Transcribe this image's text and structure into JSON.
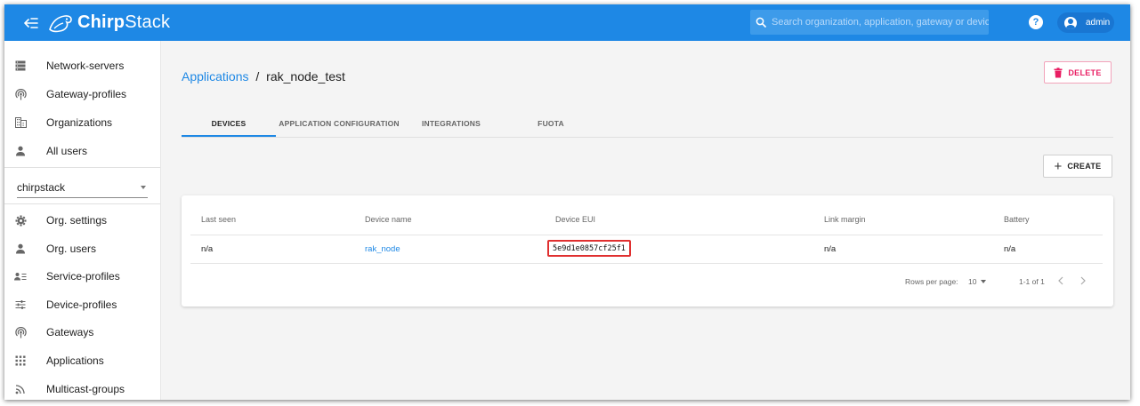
{
  "app": {
    "logo_bold": "Chirp",
    "logo_rest": "Stack"
  },
  "search": {
    "placeholder": "Search organization, application, gateway or device"
  },
  "user": {
    "help_label": "?",
    "name": "admin"
  },
  "sidebar": {
    "global_items": [
      {
        "label": "Network-servers",
        "icon": "server-icon"
      },
      {
        "label": "Gateway-profiles",
        "icon": "wifi-tethering-icon"
      },
      {
        "label": "Organizations",
        "icon": "domain-icon"
      },
      {
        "label": "All users",
        "icon": "person-icon"
      }
    ],
    "organization_selector": "chirpstack",
    "org_items": [
      {
        "label": "Org. settings",
        "icon": "gear-icon"
      },
      {
        "label": "Org. users",
        "icon": "person-icon"
      },
      {
        "label": "Service-profiles",
        "icon": "account-details-icon"
      },
      {
        "label": "Device-profiles",
        "icon": "tune-icon"
      },
      {
        "label": "Gateways",
        "icon": "wifi-tethering-icon"
      },
      {
        "label": "Applications",
        "icon": "apps-icon"
      },
      {
        "label": "Multicast-groups",
        "icon": "rss-icon"
      }
    ]
  },
  "breadcrumb": {
    "parent": "Applications",
    "separator": "/",
    "current": "rak_node_test"
  },
  "actions": {
    "delete_label": "DELETE",
    "create_label": "CREATE"
  },
  "tabs": [
    {
      "label": "DEVICES",
      "active": true
    },
    {
      "label": "APPLICATION CONFIGURATION",
      "active": false
    },
    {
      "label": "INTEGRATIONS",
      "active": false
    },
    {
      "label": "FUOTA",
      "active": false
    }
  ],
  "table": {
    "columns": [
      "Last seen",
      "Device name",
      "Device EUI",
      "Link margin",
      "Battery"
    ],
    "rows": [
      {
        "last_seen": "n/a",
        "device_name": "rak_node",
        "device_eui": "5e9d1e0857cf25f1",
        "link_margin": "n/a",
        "battery": "n/a"
      }
    ],
    "pagination": {
      "rows_per_page_label": "Rows per page:",
      "rows_per_page_value": "10",
      "range": "1-1 of 1"
    }
  },
  "colors": {
    "primary": "#1e88e5",
    "danger": "#e91e63",
    "highlight": "#e03030"
  }
}
